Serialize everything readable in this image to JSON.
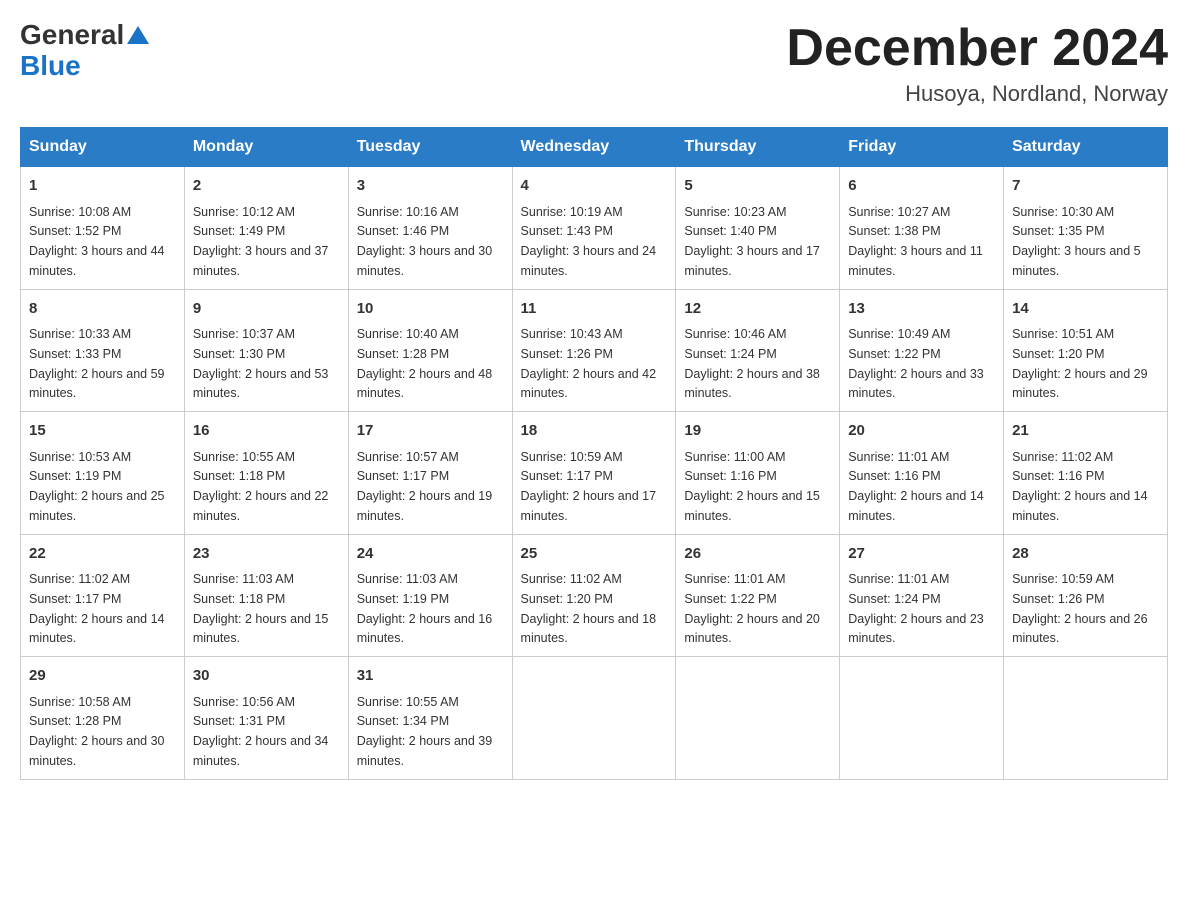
{
  "logo": {
    "general": "General",
    "blue": "Blue"
  },
  "title": {
    "month": "December 2024",
    "location": "Husoya, Nordland, Norway"
  },
  "header": {
    "days": [
      "Sunday",
      "Monday",
      "Tuesday",
      "Wednesday",
      "Thursday",
      "Friday",
      "Saturday"
    ]
  },
  "weeks": [
    [
      {
        "day": "1",
        "sunrise": "10:08 AM",
        "sunset": "1:52 PM",
        "daylight": "3 hours and 44 minutes."
      },
      {
        "day": "2",
        "sunrise": "10:12 AM",
        "sunset": "1:49 PM",
        "daylight": "3 hours and 37 minutes."
      },
      {
        "day": "3",
        "sunrise": "10:16 AM",
        "sunset": "1:46 PM",
        "daylight": "3 hours and 30 minutes."
      },
      {
        "day": "4",
        "sunrise": "10:19 AM",
        "sunset": "1:43 PM",
        "daylight": "3 hours and 24 minutes."
      },
      {
        "day": "5",
        "sunrise": "10:23 AM",
        "sunset": "1:40 PM",
        "daylight": "3 hours and 17 minutes."
      },
      {
        "day": "6",
        "sunrise": "10:27 AM",
        "sunset": "1:38 PM",
        "daylight": "3 hours and 11 minutes."
      },
      {
        "day": "7",
        "sunrise": "10:30 AM",
        "sunset": "1:35 PM",
        "daylight": "3 hours and 5 minutes."
      }
    ],
    [
      {
        "day": "8",
        "sunrise": "10:33 AM",
        "sunset": "1:33 PM",
        "daylight": "2 hours and 59 minutes."
      },
      {
        "day": "9",
        "sunrise": "10:37 AM",
        "sunset": "1:30 PM",
        "daylight": "2 hours and 53 minutes."
      },
      {
        "day": "10",
        "sunrise": "10:40 AM",
        "sunset": "1:28 PM",
        "daylight": "2 hours and 48 minutes."
      },
      {
        "day": "11",
        "sunrise": "10:43 AM",
        "sunset": "1:26 PM",
        "daylight": "2 hours and 42 minutes."
      },
      {
        "day": "12",
        "sunrise": "10:46 AM",
        "sunset": "1:24 PM",
        "daylight": "2 hours and 38 minutes."
      },
      {
        "day": "13",
        "sunrise": "10:49 AM",
        "sunset": "1:22 PM",
        "daylight": "2 hours and 33 minutes."
      },
      {
        "day": "14",
        "sunrise": "10:51 AM",
        "sunset": "1:20 PM",
        "daylight": "2 hours and 29 minutes."
      }
    ],
    [
      {
        "day": "15",
        "sunrise": "10:53 AM",
        "sunset": "1:19 PM",
        "daylight": "2 hours and 25 minutes."
      },
      {
        "day": "16",
        "sunrise": "10:55 AM",
        "sunset": "1:18 PM",
        "daylight": "2 hours and 22 minutes."
      },
      {
        "day": "17",
        "sunrise": "10:57 AM",
        "sunset": "1:17 PM",
        "daylight": "2 hours and 19 minutes."
      },
      {
        "day": "18",
        "sunrise": "10:59 AM",
        "sunset": "1:17 PM",
        "daylight": "2 hours and 17 minutes."
      },
      {
        "day": "19",
        "sunrise": "11:00 AM",
        "sunset": "1:16 PM",
        "daylight": "2 hours and 15 minutes."
      },
      {
        "day": "20",
        "sunrise": "11:01 AM",
        "sunset": "1:16 PM",
        "daylight": "2 hours and 14 minutes."
      },
      {
        "day": "21",
        "sunrise": "11:02 AM",
        "sunset": "1:16 PM",
        "daylight": "2 hours and 14 minutes."
      }
    ],
    [
      {
        "day": "22",
        "sunrise": "11:02 AM",
        "sunset": "1:17 PM",
        "daylight": "2 hours and 14 minutes."
      },
      {
        "day": "23",
        "sunrise": "11:03 AM",
        "sunset": "1:18 PM",
        "daylight": "2 hours and 15 minutes."
      },
      {
        "day": "24",
        "sunrise": "11:03 AM",
        "sunset": "1:19 PM",
        "daylight": "2 hours and 16 minutes."
      },
      {
        "day": "25",
        "sunrise": "11:02 AM",
        "sunset": "1:20 PM",
        "daylight": "2 hours and 18 minutes."
      },
      {
        "day": "26",
        "sunrise": "11:01 AM",
        "sunset": "1:22 PM",
        "daylight": "2 hours and 20 minutes."
      },
      {
        "day": "27",
        "sunrise": "11:01 AM",
        "sunset": "1:24 PM",
        "daylight": "2 hours and 23 minutes."
      },
      {
        "day": "28",
        "sunrise": "10:59 AM",
        "sunset": "1:26 PM",
        "daylight": "2 hours and 26 minutes."
      }
    ],
    [
      {
        "day": "29",
        "sunrise": "10:58 AM",
        "sunset": "1:28 PM",
        "daylight": "2 hours and 30 minutes."
      },
      {
        "day": "30",
        "sunrise": "10:56 AM",
        "sunset": "1:31 PM",
        "daylight": "2 hours and 34 minutes."
      },
      {
        "day": "31",
        "sunrise": "10:55 AM",
        "sunset": "1:34 PM",
        "daylight": "2 hours and 39 minutes."
      },
      null,
      null,
      null,
      null
    ]
  ]
}
